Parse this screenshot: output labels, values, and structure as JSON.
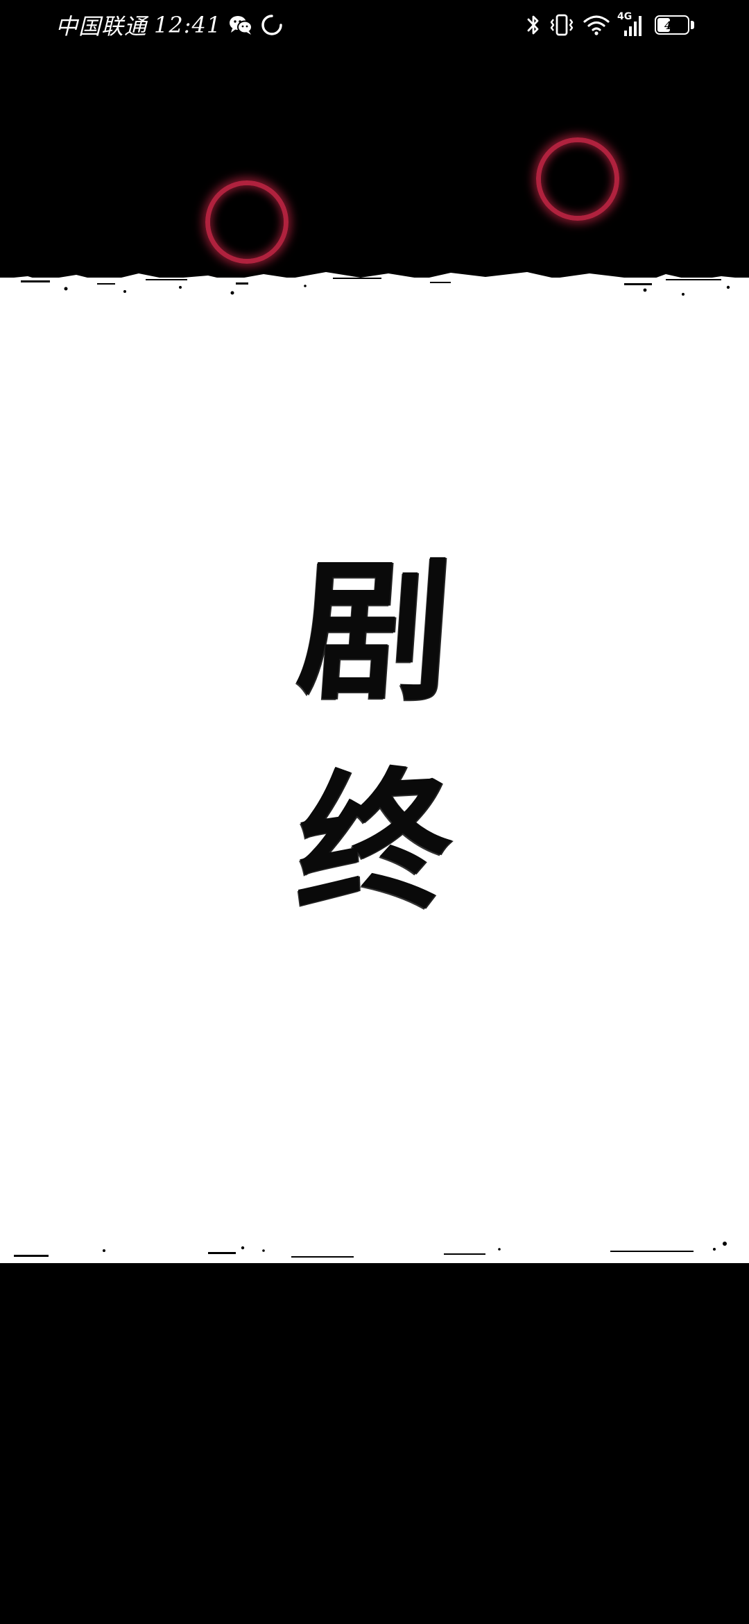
{
  "status_bar": {
    "carrier": "中国联通",
    "time": "12:41",
    "network_type": "4G",
    "battery_level": 43,
    "icons": {
      "chat_app": "wechat-icon",
      "loading": "sync-circle-icon",
      "bluetooth": "bluetooth-icon",
      "vibrate": "vibrate-icon",
      "wifi": "wifi-icon",
      "signal": "cellular-signal-icon",
      "battery": "battery-icon"
    }
  },
  "scene": {
    "title_line_1": "剧",
    "title_line_2": "终",
    "colors": {
      "background": "#000000",
      "paper": "#ffffff",
      "ring": "#b0223e",
      "ink": "#0a0a0a"
    }
  }
}
